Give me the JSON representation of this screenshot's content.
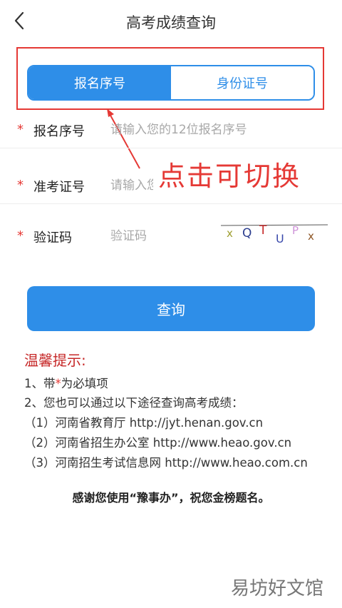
{
  "header": {
    "title": "高考成绩查询"
  },
  "tabs": [
    {
      "label": "报名序号"
    },
    {
      "label": "身份证号"
    }
  ],
  "form": {
    "required_mark": "*",
    "reg_no": {
      "label": "报名序号",
      "placeholder": "请输入您的12位报名序号"
    },
    "ticket_no": {
      "label": "准考证号",
      "placeholder": "请输入您的14位准考证号"
    },
    "captcha": {
      "label": "验证码",
      "placeholder": "验证码",
      "image_text": [
        "x",
        "Q",
        "T",
        "U",
        "P",
        "x"
      ]
    }
  },
  "annotation": {
    "callout": "点击可切换"
  },
  "actions": {
    "query_label": "查询"
  },
  "tips": {
    "title": "温馨提示:",
    "line1_prefix": "1、带",
    "line1_star": "*",
    "line1_suffix": "为必填项",
    "line2": "2、您也可以通过以下途径查询高考成绩：",
    "sources": [
      "（1）河南省教育厅 http://jyt.henan.gov.cn",
      "（2）河南省招生办公室 http://www.heao.gov.cn",
      "（3）河南招生考试信息网 http://www.heao.com.cn"
    ]
  },
  "footer": {
    "thanks": "感谢您使用“豫事办”，祝您金榜题名。"
  },
  "watermark": "易坊好文馆",
  "colors": {
    "accent": "#2e8ee8",
    "required": "#e53935",
    "tips_title": "#c62828"
  }
}
